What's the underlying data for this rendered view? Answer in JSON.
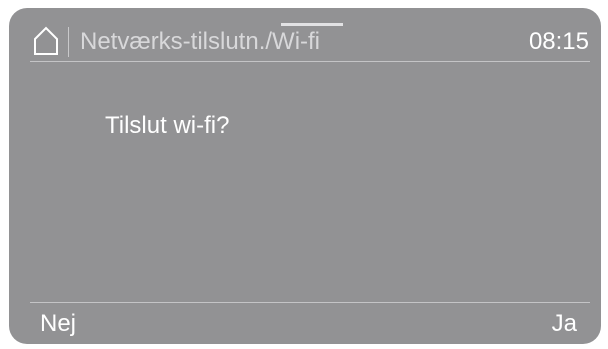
{
  "header": {
    "home_icon": "house-outline-icon",
    "title": "Netværks-tilslutn./Wi-fi",
    "time": "08:15"
  },
  "dialog": {
    "question": "Tilslut wi-fi?"
  },
  "footer": {
    "left_label": "Nej",
    "right_label": "Ja"
  },
  "colors": {
    "screen_background": "#929294",
    "text_primary": "#ffffff",
    "text_secondary": "#d8d8da",
    "divider": "#c4c4c6"
  }
}
